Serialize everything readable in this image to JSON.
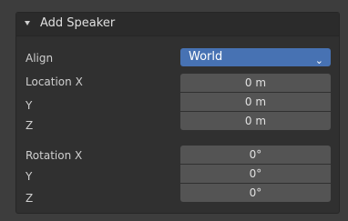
{
  "panel": {
    "title": "Add Speaker"
  },
  "align": {
    "label": "Align",
    "value": "World"
  },
  "location": {
    "label_x": "Location X",
    "label_y": "Y",
    "label_z": "Z",
    "x": "0 m",
    "y": "0 m",
    "z": "0 m"
  },
  "rotation": {
    "label_x": "Rotation X",
    "label_y": "Y",
    "label_z": "Z",
    "x": "0°",
    "y": "0°",
    "z": "0°"
  },
  "icons": {
    "header_toggle": "triangle-down-icon",
    "dropdown": "chevron-down-icon"
  },
  "colors": {
    "accent": "#4772b3",
    "field": "#545454",
    "panel": "#303030"
  }
}
